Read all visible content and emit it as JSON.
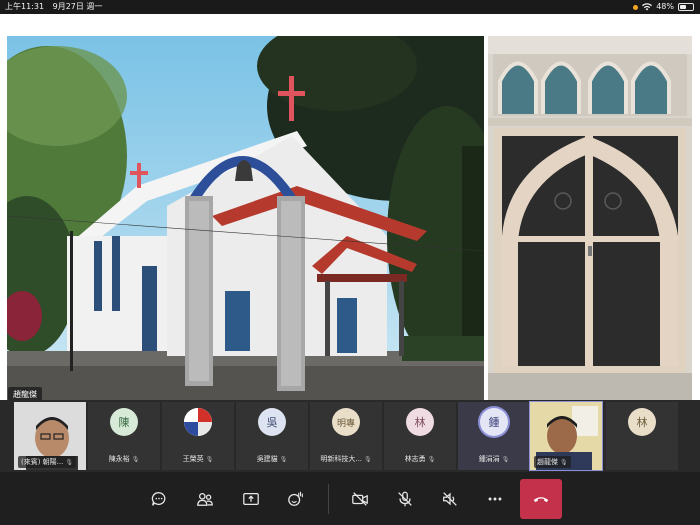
{
  "status_bar": {
    "time": "上午11:31",
    "date": "9月27日 週一",
    "battery": "48%",
    "battery_level": 0.48
  },
  "shared_content": {
    "presenter_name": "趙龍傑"
  },
  "participants": [
    {
      "initial": "",
      "name": "(來賓) 朝陽...",
      "type": "video"
    },
    {
      "initial": "陳",
      "name": "陳永裕",
      "type": "avatar"
    },
    {
      "initial": "",
      "name": "王榮英",
      "type": "avatar-flag"
    },
    {
      "initial": "吳",
      "name": "吳建貓",
      "type": "avatar"
    },
    {
      "initial": "明專",
      "name": "明新科技大...",
      "type": "avatar"
    },
    {
      "initial": "林",
      "name": "林志勇",
      "type": "avatar"
    },
    {
      "initial": "鍾",
      "name": "鍾涓涓",
      "type": "avatar-speaking"
    },
    {
      "initial": "",
      "name": "趙龍傑",
      "type": "video"
    },
    {
      "initial": "林",
      "name": "",
      "type": "avatar"
    }
  ],
  "controls": {
    "icons": [
      "chat-icon",
      "participants-icon",
      "share-screen-icon",
      "reactions-icon",
      "camera-off-icon",
      "mic-off-icon",
      "speaker-off-icon",
      "more-icon",
      "hang-up-icon"
    ]
  },
  "colors": {
    "hangup": "#c4314b",
    "speaking_ring": "#8b8fd6",
    "background": "#1f1f1f"
  }
}
